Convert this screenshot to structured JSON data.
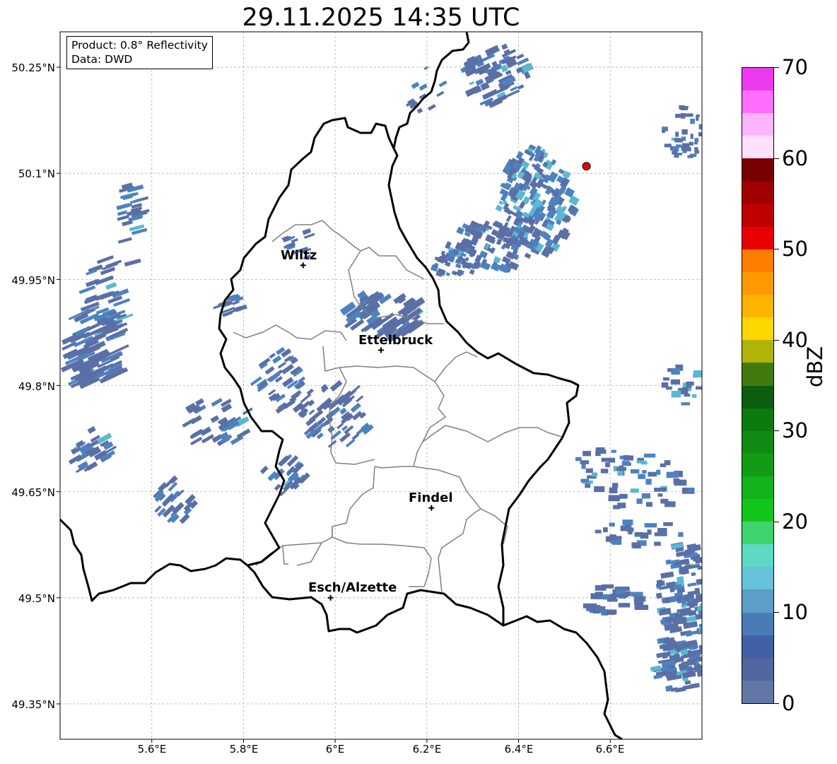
{
  "title": "29.11.2025 14:35 UTC",
  "info_box": {
    "product": "Product: 0.8° Reflectivity",
    "source": "Data: DWD"
  },
  "lat_labels": [
    "50.25°N",
    "50.1°N",
    "49.95°N",
    "49.8°N",
    "49.65°N",
    "49.5°N",
    "49.35°N"
  ],
  "lon_labels": [
    "5.6°E",
    "5.8°E",
    "6°E",
    "6.2°E",
    "6.4°E",
    "6.6°E"
  ],
  "cities": [
    {
      "name": "Wiltz",
      "lon": 5.93,
      "lat": 49.97
    },
    {
      "name": "Ettelbruck",
      "lon": 6.1,
      "lat": 49.85
    },
    {
      "name": "Findel",
      "lon": 6.21,
      "lat": 49.627
    },
    {
      "name": "Esch/Alzette",
      "lon": 5.99,
      "lat": 49.5
    }
  ],
  "radar_site": {
    "lon": 6.548,
    "lat": 50.11,
    "color": "#e8000b"
  },
  "extent": {
    "lon": [
      5.4,
      6.8
    ],
    "lat": [
      49.3,
      50.3
    ]
  },
  "colorbar": {
    "label": "dBZ",
    "ticks": [
      "0",
      "10",
      "20",
      "30",
      "40",
      "50",
      "60",
      "70"
    ],
    "range": [
      0,
      70
    ],
    "colors": [
      "#6377a6",
      "#52669f",
      "#4260a8",
      "#4a7bb4",
      "#5b9ec6",
      "#66c3da",
      "#5fd8c4",
      "#3dd46b",
      "#12c61b",
      "#14b21c",
      "#129c15",
      "#108a12",
      "#0c7a0f",
      "#0a5e0d",
      "#437a0f",
      "#b0b408",
      "#ffd700",
      "#ffb400",
      "#ff9b00",
      "#ff7d00",
      "#e80000",
      "#c00000",
      "#a00000",
      "#780000",
      "#ffe0ff",
      "#ffb4ff",
      "#ff6eff",
      "#ec3bee"
    ]
  },
  "echo_colors": {
    "weak": "#5a6fa6",
    "moderate": "#4d82c0",
    "strong": "#5ab8d2"
  }
}
